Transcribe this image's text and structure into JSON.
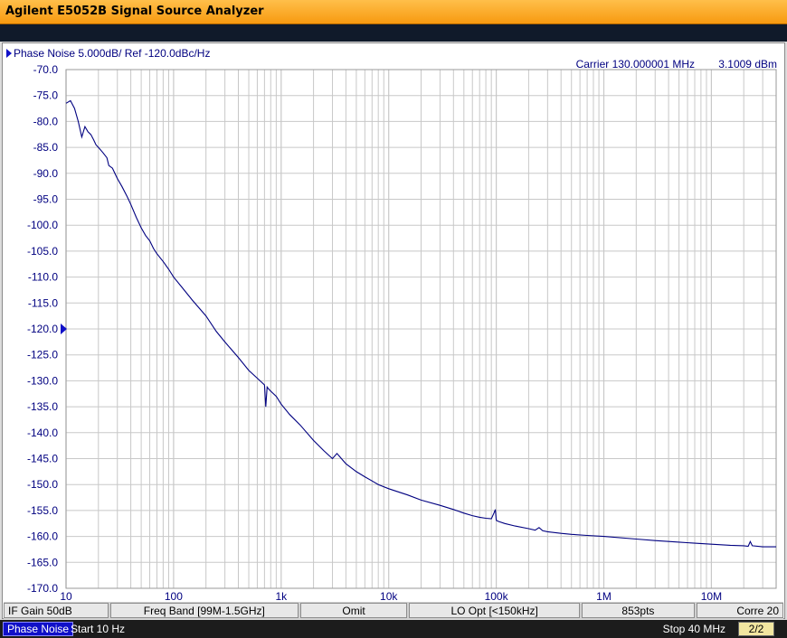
{
  "app": {
    "title": "Agilent E5052B Signal Source Analyzer"
  },
  "colors": {
    "trace": "#000080",
    "grid": "#c8c8c8",
    "title_bar": "#f7a21b",
    "active_tab": "#1010c8"
  },
  "header": {
    "measurement": "Phase Noise 5.000dB/ Ref -120.0dBc/Hz",
    "carrier": "Carrier 130.000001 MHz",
    "power": "3.1009 dBm"
  },
  "status": {
    "if_gain": "IF Gain 50dB",
    "freq_band": "Freq Band [99M-1.5GHz]",
    "omit": "Omit",
    "lo_opt": "LO Opt [<150kHz]",
    "points": "853pts",
    "corre": "Corre 20"
  },
  "footer": {
    "trace_tab": "Phase Noise",
    "start": "Start 10 Hz",
    "stop": "Stop 40 MHz",
    "page": "2/2"
  },
  "chart_data": {
    "type": "line",
    "xscale": "log",
    "xlim": [
      10,
      40000000
    ],
    "ylim": [
      -170,
      -70
    ],
    "ref_level": -120.0,
    "grid": true,
    "x_ticks": [
      {
        "value": 10,
        "label": "10"
      },
      {
        "value": 100,
        "label": "100"
      },
      {
        "value": 1000,
        "label": "1k"
      },
      {
        "value": 10000,
        "label": "10k"
      },
      {
        "value": 100000,
        "label": "100k"
      },
      {
        "value": 1000000,
        "label": "1M"
      },
      {
        "value": 10000000,
        "label": "10M"
      }
    ],
    "y_ticks": [
      {
        "value": -70,
        "label": "-70.0"
      },
      {
        "value": -75,
        "label": "-75.0"
      },
      {
        "value": -80,
        "label": "-80.0"
      },
      {
        "value": -85,
        "label": "-85.0"
      },
      {
        "value": -90,
        "label": "-90.0"
      },
      {
        "value": -95,
        "label": "-95.0"
      },
      {
        "value": -100,
        "label": "-100.0"
      },
      {
        "value": -105,
        "label": "-105.0"
      },
      {
        "value": -110,
        "label": "-110.0"
      },
      {
        "value": -115,
        "label": "-115.0"
      },
      {
        "value": -120,
        "label": "-120.0"
      },
      {
        "value": -125,
        "label": "-125.0"
      },
      {
        "value": -130,
        "label": "-130.0"
      },
      {
        "value": -135,
        "label": "-135.0"
      },
      {
        "value": -140,
        "label": "-140.0"
      },
      {
        "value": -145,
        "label": "-145.0"
      },
      {
        "value": -150,
        "label": "-150.0"
      },
      {
        "value": -155,
        "label": "-155.0"
      },
      {
        "value": -160,
        "label": "-160.0"
      },
      {
        "value": -165,
        "label": "-165.0"
      },
      {
        "value": -170,
        "label": "-170.0"
      }
    ],
    "series": [
      {
        "x": [
          10,
          11,
          12,
          13,
          14,
          15,
          16,
          17,
          18,
          19,
          20,
          22,
          24,
          25,
          27,
          30,
          33,
          37,
          40,
          45,
          50,
          55,
          60,
          65,
          70,
          80,
          90,
          100,
          120,
          150,
          200,
          250,
          300,
          400,
          500,
          600,
          700,
          720,
          740,
          760,
          800,
          900,
          1000,
          1200,
          1500,
          2000,
          2500,
          3000,
          3300,
          3500,
          3700,
          4000,
          5000,
          6000,
          7000,
          8000,
          10000,
          15000,
          20000,
          30000,
          40000,
          50000,
          60000,
          70000,
          80000,
          90000,
          95000,
          98000,
          100000,
          105000,
          120000,
          150000,
          200000,
          230000,
          250000,
          270000,
          300000,
          400000,
          500000,
          700000,
          1000000,
          2000000,
          3000000,
          5000000,
          7000000,
          10000000,
          15000000,
          20000000,
          22000000,
          23000000,
          24000000,
          30000000,
          40000000
        ],
        "y": [
          -76.5,
          -76.0,
          -77.5,
          -80.0,
          -83.0,
          -81.0,
          -82.0,
          -82.5,
          -83.5,
          -84.5,
          -85.0,
          -86.0,
          -87.0,
          -88.5,
          -89.0,
          -91.0,
          -92.5,
          -94.5,
          -96.0,
          -98.5,
          -100.5,
          -102.0,
          -103.0,
          -104.5,
          -105.5,
          -107.0,
          -108.5,
          -110.0,
          -112.0,
          -114.5,
          -117.5,
          -120.5,
          -122.5,
          -125.5,
          -128.0,
          -129.5,
          -130.8,
          -135.0,
          -131.2,
          -131.5,
          -132.0,
          -133.0,
          -134.5,
          -136.5,
          -138.5,
          -141.5,
          -143.5,
          -145.0,
          -144.0,
          -144.6,
          -145.2,
          -146.0,
          -147.5,
          -148.5,
          -149.3,
          -150.0,
          -150.8,
          -152.0,
          -153.0,
          -154.0,
          -154.8,
          -155.5,
          -156.0,
          -156.3,
          -156.5,
          -156.6,
          -155.5,
          -154.8,
          -156.9,
          -157.1,
          -157.5,
          -158.0,
          -158.5,
          -158.8,
          -158.3,
          -158.9,
          -159.1,
          -159.4,
          -159.6,
          -159.8,
          -160.0,
          -160.5,
          -160.8,
          -161.1,
          -161.3,
          -161.5,
          -161.7,
          -161.8,
          -161.9,
          -161.0,
          -161.8,
          -162.0,
          -162.0
        ]
      }
    ]
  }
}
